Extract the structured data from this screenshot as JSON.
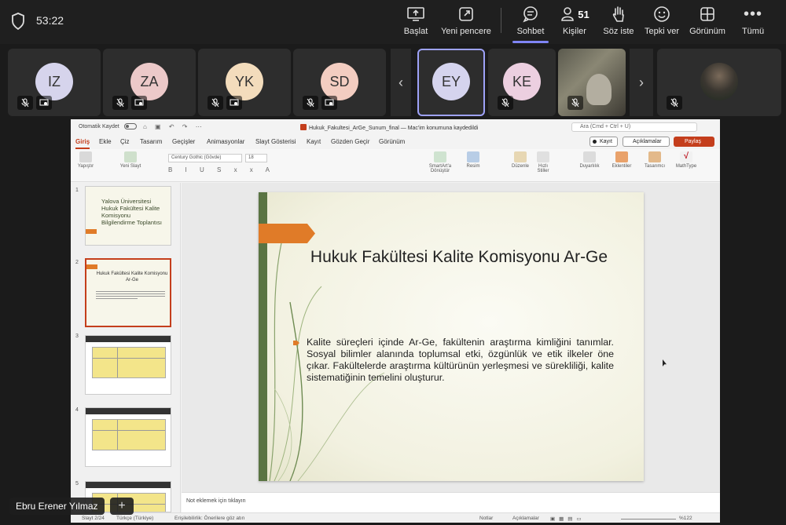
{
  "meeting": {
    "timer": "53:22",
    "toolbar": {
      "start": "Başlat",
      "new_window": "Yeni pencere",
      "chat": "Sohbet",
      "people": "Kişiler",
      "people_count": "51",
      "raise_hand": "Söz iste",
      "react": "Tepki ver",
      "view": "Görünüm",
      "more": "Tümü"
    },
    "participants": [
      {
        "initials": "IZ",
        "color": "#d6d4ec"
      },
      {
        "initials": "ZA",
        "color": "#ecc9c9"
      },
      {
        "initials": "YK",
        "color": "#f3dcbc"
      },
      {
        "initials": "SD",
        "color": "#f3cdc1"
      },
      {
        "initials": "EY",
        "color": "#d5d4ee",
        "active": true
      },
      {
        "initials": "KE",
        "color": "#eccfe0"
      }
    ],
    "presenter_name": "Ebru Erener Yılmaz"
  },
  "ppt": {
    "autosave": "Otomatik Kaydet",
    "doc_title": "Hukuk_Fakultesi_ArGe_Sunum_final",
    "doc_saved": "Mac'im konumuna kaydedildi",
    "search_placeholder": "Ara (Cmd + Ctrl + U)",
    "tabs": [
      "Giriş",
      "Ekle",
      "Çiz",
      "Tasarım",
      "Geçişler",
      "Animasyonlar",
      "Slayt Gösterisi",
      "Kayıt",
      "Gözden Geçir",
      "Görünüm"
    ],
    "record": "Kayıt",
    "comments": "Açıklamalar",
    "share": "Paylaş",
    "ribbon": {
      "paste": "Yapıştır",
      "new_slide": "Yeni Slayt",
      "font": "Century Gothic (Gövde)",
      "size": "18",
      "smartart": "SmartArt'a Dönüştür",
      "picture": "Resim",
      "arrange": "Düzenle",
      "quick_styles": "Hızlı Stiller",
      "sensitivity": "Duyarlılık",
      "addins": "Eklentiler",
      "designer": "Tasarımcı",
      "mathtype": "MathType"
    },
    "thumbs": {
      "t1_title": "Yalova Üniversitesi Hukuk Fakültesi Kalite Komisyonu Bilgilendirme Toplantısı",
      "t2_title": "Hukuk Fakültesi Kalite Komisyonu Ar-Ge",
      "numbers": [
        "1",
        "2",
        "3",
        "4",
        "5"
      ]
    },
    "slide": {
      "title": "Hukuk Fakültesi Kalite Komisyonu Ar-Ge",
      "body": "Kalite süreçleri içinde Ar-Ge, fakültenin araştırma kimliğini tanımlar. Sosyal bilimler alanında toplumsal etki, özgünlük ve etik ilkeler öne çıkar. Fakültelerde araştırma kültürünün yerleşmesi ve sürekliliği, kalite sistematiğinin temelini oluşturur."
    },
    "notes_placeholder": "Not eklemek için tıklayın",
    "status": {
      "slide": "Slayt 2/24",
      "lang": "Türkçe (Türkiye)",
      "accessibility": "Erişilebilirlik: Önerilere göz atın",
      "notes": "Notlar",
      "comments": "Açıklamalar",
      "zoom": "%122"
    }
  }
}
